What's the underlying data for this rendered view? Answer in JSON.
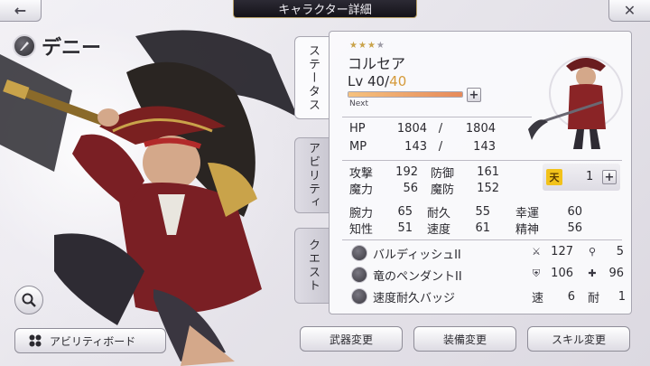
{
  "header": {
    "title": "キャラクター詳細",
    "back_icon": "back-arrow-icon",
    "close_icon": "close-icon"
  },
  "character": {
    "name": "デニー"
  },
  "tabs": [
    {
      "label": "ステータス",
      "active": true
    },
    {
      "label": "アビリティ",
      "active": false
    },
    {
      "label": "クエスト",
      "active": false
    }
  ],
  "status": {
    "rarity_total": 4,
    "rarity_filled": 3,
    "job": "コルセア",
    "lv_label": "Lv",
    "lv_current": "40",
    "lv_sep": "/",
    "lv_max": "40",
    "exp_fraction": 1.0,
    "next_label": "Next",
    "hp_label": "HP",
    "hp_current": "1804",
    "hp_sep": "/",
    "hp_max": "1804",
    "mp_label": "MP",
    "mp_current": "143",
    "mp_sep": "/",
    "mp_max": "143",
    "stats_row1": [
      {
        "label": "攻撃",
        "value": "192"
      },
      {
        "label": "防御",
        "value": "161"
      }
    ],
    "stats_row2": [
      {
        "label": "魔力",
        "value": "56"
      },
      {
        "label": "魔防",
        "value": "152"
      }
    ],
    "rank_value": "1",
    "stats_row3": [
      {
        "label": "腕力",
        "value": "65"
      },
      {
        "label": "耐久",
        "value": "55"
      },
      {
        "label": "幸運",
        "value": "60"
      }
    ],
    "stats_row4": [
      {
        "label": "知性",
        "value": "51"
      },
      {
        "label": "速度",
        "value": "61"
      },
      {
        "label": "精神",
        "value": "56"
      }
    ]
  },
  "equipment": [
    {
      "name": "バルディッシュII",
      "stat1": "127",
      "stat2": "5"
    },
    {
      "name": "竜のペンダントII",
      "stat1": "106",
      "stat2": "96"
    },
    {
      "name": "速度耐久バッジ",
      "stat1_label": "速",
      "stat1": "6",
      "stat2_label": "耐",
      "stat2": "1"
    }
  ],
  "buttons": {
    "ability_board": "アビリティボード",
    "weapon_change": "武器変更",
    "equip_change": "装備変更",
    "skill_change": "スキル変更"
  },
  "colors": {
    "accent_gold": "#d59a3a",
    "title_bar": "#1d1b24"
  }
}
